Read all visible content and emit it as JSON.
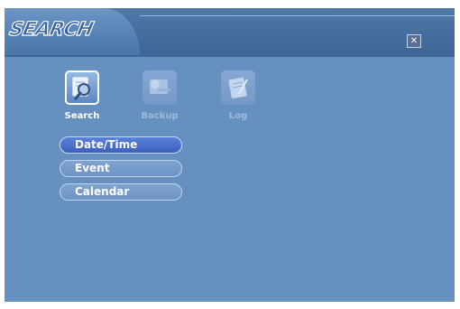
{
  "window": {
    "title": "SEARCH"
  },
  "modes": [
    {
      "label": "Search",
      "icon": "search-magnifier-icon",
      "active": true
    },
    {
      "label": "Backup",
      "icon": "backup-disc-icon",
      "active": false
    },
    {
      "label": "Log",
      "icon": "log-notepad-icon",
      "active": false
    }
  ],
  "menu": [
    {
      "label": "Date/Time",
      "selected": true
    },
    {
      "label": "Event",
      "selected": false
    },
    {
      "label": "Calendar",
      "selected": false
    }
  ],
  "colors": {
    "panel": "#6690bf",
    "titlebar": "#3d6596",
    "selected_button": "#3a60bc"
  }
}
